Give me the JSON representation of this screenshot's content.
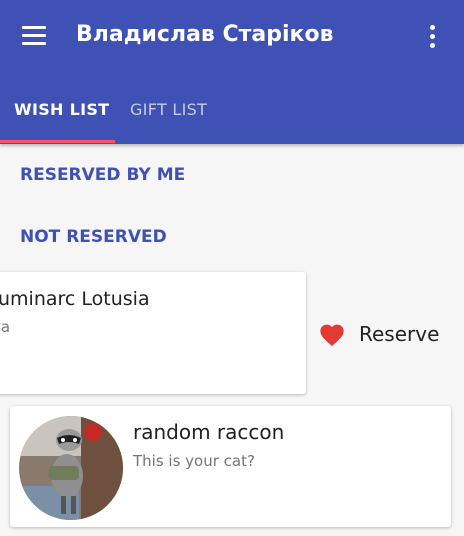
{
  "app_bar": {
    "title": "Владислав Старіков",
    "menu_icon": "menu-icon",
    "more_icon": "more-vert-icon",
    "background": "#3f51b5"
  },
  "tabs": [
    {
      "label": "WISH LIST",
      "active": true
    },
    {
      "label": "GIFT LIST",
      "active": false
    }
  ],
  "accent_color": "#ff4f6e",
  "filters": {
    "reserved_by_me": "RESERVED BY ME",
    "not_reserved": "NOT RESERVED"
  },
  "wishes": [
    {
      "title": "uminarc Lotusia",
      "subtitle": "ya",
      "action": {
        "icon": "heart-icon",
        "label": "Reserve",
        "color": "#e53935"
      }
    },
    {
      "title": "random raccon",
      "subtitle": "This is your cat?",
      "image": "raccoon-avatar"
    }
  ]
}
